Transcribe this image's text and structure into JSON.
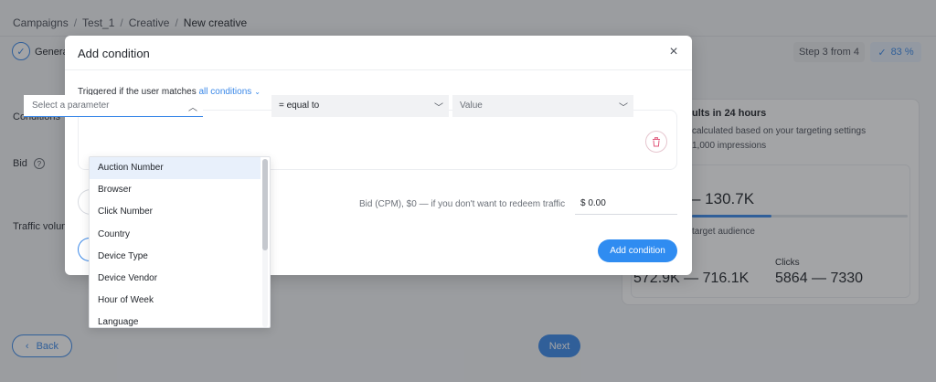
{
  "breadcrumb": {
    "items": [
      "Campaigns",
      "Test_1",
      "Creative"
    ],
    "current": "New creative",
    "separator": "/"
  },
  "steps": {
    "current_step_label": "Genera",
    "step_info": "Step 3 from 4",
    "progress": "83 %"
  },
  "form": {
    "conditions_label": "Conditions",
    "bid_label": "Bid",
    "traffic_label": "Traffic volum"
  },
  "results": {
    "title": "ults in 24 hours",
    "subtitle1": "calculated based on your targeting settings",
    "subtitle2": "1,000 impressions",
    "range": "– 130.7K",
    "range_fill_fraction": 0.37,
    "range_caption": "target audience",
    "impressions_value": "572.9K — 716.1K",
    "clicks_label": "Clicks",
    "clicks_value": "5864 — 7330"
  },
  "footer": {
    "back_label": "Back",
    "next_label": "Next"
  },
  "modal": {
    "title": "Add condition",
    "close_icon": "close-icon",
    "trigger_prefix": "Triggered if the user matches",
    "trigger_link": "all conditions",
    "parameter_placeholder": "Select a parameter",
    "operator_value": "= equal to",
    "value_placeholder": "Value",
    "bid_label": "Bid (CPM), $0 — if you don't want to redeem traffic",
    "bid_value": "$ 0.00",
    "add_condition_label": "Add condition"
  },
  "dropdown": {
    "options": [
      "Auction Number",
      "Browser",
      "Click Number",
      "Country",
      "Device Type",
      "Device Vendor",
      "Hour of Week",
      "Language"
    ],
    "highlighted_index": 0
  },
  "colors": {
    "accent": "#3a88e8",
    "button_primary": "#2f8cf1",
    "delete": "#e0567a"
  }
}
